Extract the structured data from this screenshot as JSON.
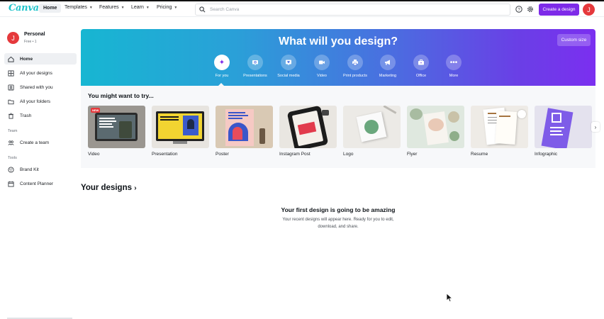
{
  "app": {
    "logo": "Canva"
  },
  "nav": {
    "home": "Home",
    "templates": "Templates",
    "features": "Features",
    "learn": "Learn",
    "pricing": "Pricing"
  },
  "search": {
    "placeholder": "Search Canva"
  },
  "header": {
    "create_design": "Create a design",
    "avatar_initial": "J"
  },
  "account": {
    "initial": "J",
    "name": "Personal",
    "plan": "Free • 1"
  },
  "sidebar": {
    "items": [
      {
        "label": "Home",
        "icon": "home-icon"
      },
      {
        "label": "All your designs",
        "icon": "grid-icon"
      },
      {
        "label": "Shared with you",
        "icon": "shared-icon"
      },
      {
        "label": "All your folders",
        "icon": "folder-icon"
      },
      {
        "label": "Trash",
        "icon": "trash-icon"
      }
    ],
    "team_heading": "Team",
    "team_items": [
      {
        "label": "Create a team",
        "icon": "team-icon"
      }
    ],
    "tools_heading": "Tools",
    "tools_items": [
      {
        "label": "Brand Kit",
        "icon": "brand-kit-icon"
      },
      {
        "label": "Content Planner",
        "icon": "calendar-icon"
      }
    ]
  },
  "hero": {
    "title": "What will you design?",
    "custom_size": "Custom size",
    "categories": [
      {
        "label": "For you",
        "icon": "sparkle-icon"
      },
      {
        "label": "Presentations",
        "icon": "presentation-icon"
      },
      {
        "label": "Social media",
        "icon": "heart-icon"
      },
      {
        "label": "Video",
        "icon": "video-icon"
      },
      {
        "label": "Print products",
        "icon": "printer-icon"
      },
      {
        "label": "Marketing",
        "icon": "megaphone-icon"
      },
      {
        "label": "Office",
        "icon": "briefcase-icon"
      },
      {
        "label": "More",
        "icon": "more-icon"
      }
    ]
  },
  "suggestions": {
    "title": "You might want to try...",
    "badge_new": "NEW",
    "cards": [
      {
        "label": "Video"
      },
      {
        "label": "Presentation"
      },
      {
        "label": "Poster"
      },
      {
        "label": "Instagram Post"
      },
      {
        "label": "Logo"
      },
      {
        "label": "Flyer"
      },
      {
        "label": "Resume"
      },
      {
        "label": "Infographic"
      }
    ]
  },
  "your_designs": {
    "title": "Your designs",
    "empty_title": "Your first design is going to be amazing",
    "empty_line1": "Your recent designs will appear here. Ready for you to edit,",
    "empty_line2": "download, and share."
  },
  "colors": {
    "accent": "#7d2ae8",
    "avatar": "#e5393c",
    "logo": "#20c4cb"
  }
}
